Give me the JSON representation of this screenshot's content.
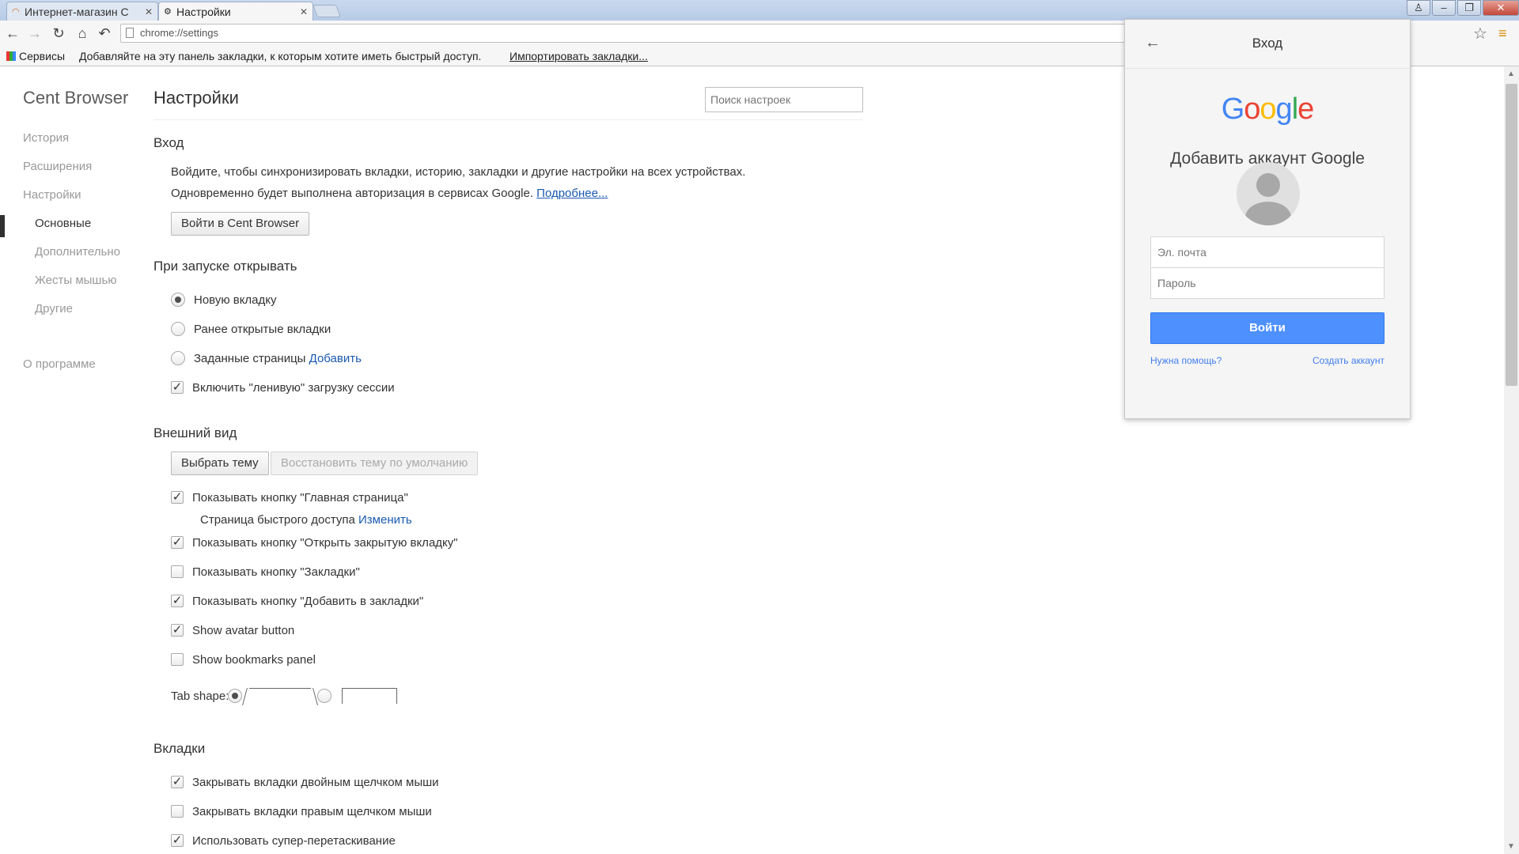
{
  "tabs": [
    {
      "label": "Интернет-магазин C",
      "icon": "rainbow-icon"
    },
    {
      "label": "Настройки",
      "icon": "gear-icon"
    }
  ],
  "toolbar": {
    "url": "chrome://settings"
  },
  "bookmarks_bar": {
    "apps_label": "Сервисы",
    "hint": "Добавляйте на эту панель закладки, к которым хотите иметь быстрый доступ.",
    "import_link": "Импортировать закладки..."
  },
  "sidebar": {
    "brand": "Cent Browser",
    "items": [
      {
        "label": "История"
      },
      {
        "label": "Расширения"
      },
      {
        "label": "Настройки"
      },
      {
        "label": "Основные",
        "selected": true
      },
      {
        "label": "Дополнительно"
      },
      {
        "label": "Жесты мышью"
      },
      {
        "label": "Другие"
      },
      {
        "label": "О программе"
      }
    ]
  },
  "settings": {
    "title": "Настройки",
    "search_placeholder": "Поиск настроек",
    "signin": {
      "heading": "Вход",
      "line1": "Войдите, чтобы синхронизировать вкладки, историю, закладки и другие настройки на всех устройствах.",
      "line2": "Одновременно будет выполнена авторизация в сервисах Google.",
      "more_link": "Подробнее...",
      "button": "Войти в Cent Browser"
    },
    "startup": {
      "heading": "При запуске открывать",
      "new_tab": "Новую вкладку",
      "prev_tabs": "Ранее открытые вкладки",
      "set_pages": "Заданные страницы",
      "add_link": "Добавить",
      "lazy": "Включить \"ленивую\" загрузку сессии"
    },
    "appearance": {
      "heading": "Внешний вид",
      "choose_theme": "Выбрать тему",
      "reset_theme": "Восстановить тему по умолчанию",
      "home_button": "Показывать кнопку \"Главная страница\"",
      "quick_access": "Страница быстрого доступа",
      "change_link": "Изменить",
      "closed_tab": "Показывать кнопку \"Открыть закрытую вкладку\"",
      "bookmarks_btn": "Показывать кнопку \"Закладки\"",
      "add_bookmark_btn": "Показывать кнопку \"Добавить в закладки\"",
      "avatar_btn": "Show avatar button",
      "bookmarks_panel": "Show bookmarks panel",
      "tab_shape": "Tab shape:"
    },
    "tabs_section": {
      "heading": "Вкладки",
      "dbl_click": "Закрывать вкладки двойным щелчком мыши",
      "right_click": "Закрывать вкладки правым щелчком мыши",
      "super_drag": "Использовать супер-перетаскивание"
    }
  },
  "popup": {
    "title": "Вход",
    "logo": "Google",
    "heading": "Добавить аккаунт Google",
    "email_placeholder": "Эл. почта",
    "password_placeholder": "Пароль",
    "signin_button": "Войти",
    "help_link": "Нужна помощь?",
    "create_link": "Создать аккаунт"
  },
  "colors": {
    "accent_blue": "#4d90fe",
    "link": "#1a5ab2"
  }
}
